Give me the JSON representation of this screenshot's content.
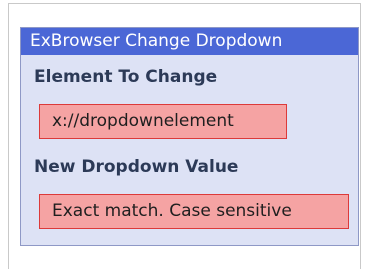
{
  "activity": {
    "title": "ExBrowser Change Dropdown",
    "fields": [
      {
        "label": "Element To Change",
        "value": "x://dropdownelement"
      },
      {
        "label": "New Dropdown Value",
        "value": "Exact match. Case sensitive"
      }
    ]
  },
  "colors": {
    "header_bg": "#4b67d6",
    "panel_bg": "#dde2f5",
    "field_bg": "#f5a3a3",
    "field_border": "#dc3a3a"
  }
}
